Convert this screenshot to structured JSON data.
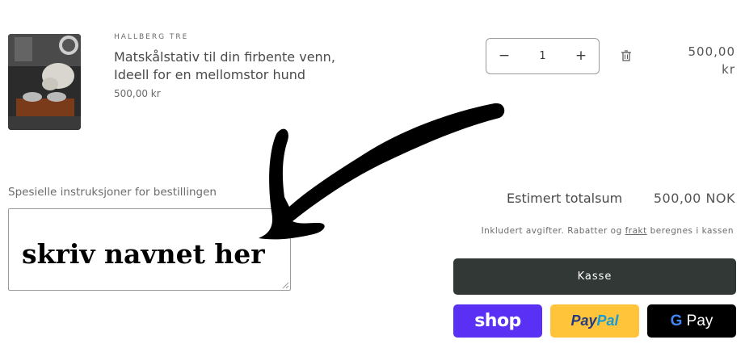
{
  "product": {
    "vendor": "HALLBERG TRE",
    "name": "Matskålstativ til din firbente venn, Ideell for en mellomstor hund",
    "price": "500,00 kr",
    "quantity": "1",
    "minus_label": "−",
    "plus_label": "+",
    "line_price": "500,00 kr"
  },
  "instructions": {
    "label": "Spesielle instruksjoner for bestillingen",
    "value": "skriv navnet her"
  },
  "totals": {
    "label": "Estimert totalsum",
    "value": "500,00 NOK",
    "note_pre": "Inkludert avgifter. Rabatter og ",
    "note_link": "frakt",
    "note_post": " beregnes i kassen"
  },
  "checkout": {
    "kasse_label": "Kasse",
    "shop_label": "shop",
    "paypal_part1": "Pay",
    "paypal_part2": "Pal",
    "gpay_label": "Pay"
  },
  "icons": {
    "trash": "trash-icon",
    "arrow": "hand-drawn-arrow-icon"
  },
  "colors": {
    "kasse_bg": "#313835",
    "shop_bg": "#5a31f4",
    "paypal_bg": "#ffc439",
    "gpay_bg": "#000000"
  }
}
